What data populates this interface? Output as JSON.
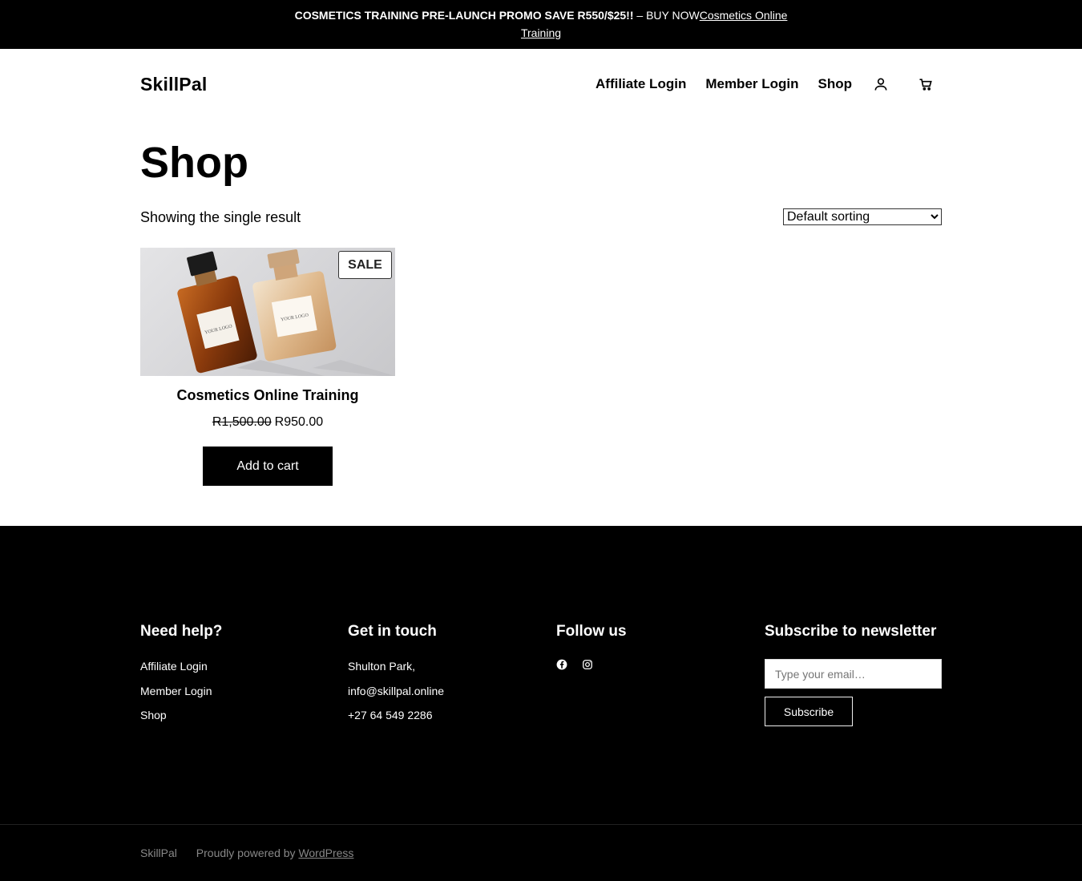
{
  "promo": {
    "bold_text": "COSMETICS TRAINING PRE-LAUNCH PROMO SAVE R550/$25!!",
    "text": " – BUY NOW",
    "link": "Cosmetics Online Training"
  },
  "header": {
    "logo": "SkillPal",
    "nav": [
      "Affiliate Login",
      "Member Login",
      "Shop"
    ]
  },
  "main": {
    "title": "Shop",
    "result_count": "Showing the single result",
    "sorting": {
      "selected": "Default sorting"
    }
  },
  "product": {
    "badge": "SALE",
    "title": "Cosmetics Online Training",
    "old_price": "R1,500.00",
    "price": "R950.00",
    "button": "Add to cart",
    "image_label_1": "YOUR LOGO",
    "image_label_2": "YOUR LOGO"
  },
  "footer": {
    "help": {
      "heading": "Need help?",
      "links": [
        "Affiliate Login",
        "Member Login",
        "Shop"
      ]
    },
    "contact": {
      "heading": "Get in touch",
      "lines": [
        "Shulton Park,",
        "info@skillpal.online",
        "+27 64 549 2286"
      ]
    },
    "follow": {
      "heading": "Follow us",
      "icons": [
        "facebook-icon",
        "instagram-icon"
      ]
    },
    "newsletter": {
      "heading": "Subscribe to newsletter",
      "placeholder": "Type your email…",
      "button": "Subscribe"
    },
    "bottom": {
      "site_name": "SkillPal",
      "powered_text": "Proudly powered by ",
      "powered_link": "WordPress"
    }
  },
  "colors": {
    "background": "#ffffff",
    "dark": "#000000",
    "muted": "#888888"
  }
}
